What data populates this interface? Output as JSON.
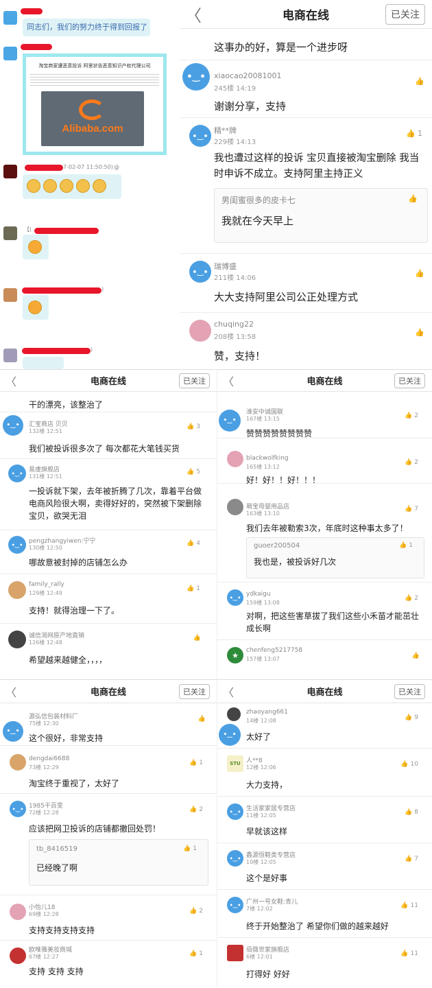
{
  "chat": {
    "message1": "同志们，我们的努力终于得到回报了",
    "news_headline": "淘宝商家遭恶意投诉 阿里状告恶意知识产权代理公司",
    "news_logo": "Alibaba.com",
    "timestamp": "7-02-07 11:50:50)",
    "at_sign": "@",
    "bracket1": "【(",
    "bracket2": ")",
    "bracket3": ")"
  },
  "panel1": {
    "header": {
      "back": "〈",
      "title": "电商在线",
      "follow": "已关注"
    },
    "posts": [
      {
        "text": "这事办的好，算是一个进步呀"
      },
      {
        "user": "xiaocao20081001",
        "meta": "245楼 14:19",
        "text": "谢谢分享，支持",
        "likes": ""
      },
      {
        "user": "精**牌",
        "meta": "229楼 14:13",
        "text": "我也遭过这样的投诉 宝贝直接被淘宝删除 我当时申诉不成立。支持阿里主持正义",
        "likes": "1",
        "reply": {
          "user": "男闺蜜很多的皮卡七",
          "text": "我就在今天早上"
        }
      },
      {
        "user": "瑞博盛",
        "meta": "211楼 14:06",
        "text": "大大支持阿里公司公正处理方式",
        "likes": ""
      },
      {
        "user": "chuqing22",
        "meta": "208楼 13:58",
        "text": "赞，支持！",
        "likes": ""
      }
    ]
  },
  "panel2": {
    "header": {
      "back": "〈",
      "title": "电商在线",
      "follow": "已关注"
    },
    "posts": [
      {
        "text": "干的漂亮，该整治了"
      },
      {
        "user": "汇宝商店 贝贝",
        "meta": "132楼 12:51",
        "text": "我们被投诉很多次了 每次都花大笔钱买货",
        "likes": "3"
      },
      {
        "user": "易虔旗舰店",
        "meta": "131楼 12:51",
        "text": "一投诉就下架，去年被折腾了几次，靠着平台做电商风险很大啊，卖得好好的，突然被下架删除宝贝，欲哭无泪",
        "likes": "5"
      },
      {
        "user": "pengzhangyiwen:宁宁",
        "meta": "130楼 12:50",
        "text": "哪故意被封掉的店铺怎么办",
        "likes": "4"
      },
      {
        "user": "family_rally",
        "meta": "129楼 12:49",
        "text": "支持！就得治理一下了。",
        "likes": "1"
      },
      {
        "user": "诚信渴网原产地直销",
        "meta": "126楼 12:48",
        "text": "希望越来越健全，，，，",
        "likes": ""
      }
    ]
  },
  "panel3": {
    "header": {
      "back": "〈",
      "title": "电商在线",
      "follow": "已关注"
    },
    "posts": [
      {
        "user": "淮安中诚国联",
        "meta": "167楼 13:15",
        "text": "赞赞赞赞赞赞赞赞",
        "likes": "2"
      },
      {
        "user": "blackwolfking",
        "meta": "165楼 13:12",
        "text": "好！好！！好！！！",
        "likes": "2"
      },
      {
        "user": "萌宝母婴用品店",
        "meta": "163楼 13:10",
        "text": "我们去年被勒索3次，年底时这种事太多了！",
        "likes": "7",
        "reply": {
          "user": "guoer200504",
          "text": "我也是，被投诉好几次",
          "likes": "1"
        }
      },
      {
        "user": "ydkaigu",
        "meta": "159楼 13:08",
        "text": "对啊，把这些害草拔了我们这些小禾苗才能茁壮成长啊",
        "likes": "2"
      },
      {
        "user": "chenfeng5217758",
        "meta": "157楼 13:07",
        "text": "",
        "likes": ""
      }
    ]
  },
  "panel4": {
    "header": {
      "back": "〈",
      "title": "电商在线",
      "follow": "已关注"
    },
    "posts": [
      {
        "user": "源弘信包装材料厂",
        "meta": "75楼 12:30",
        "text": "这个很好，非常支持",
        "likes": ""
      },
      {
        "user": "dengdai6688",
        "meta": "73楼 12:29",
        "text": "淘宝终于重视了，太好了",
        "likes": "1"
      },
      {
        "user": "1985干百变",
        "meta": "72楼 12:28",
        "text": "应该把网卫投诉的店铺都撤回处罚！",
        "likes": "2",
        "reply": {
          "user": "tb_8416519",
          "text": "已经晚了啊",
          "likes": "1"
        }
      },
      {
        "user": "小怡儿18",
        "meta": "69楼 12:28",
        "text": "支持支持支持支持",
        "likes": "2"
      },
      {
        "user": "欧唯雅美妆商城",
        "meta": "67楼 12:27",
        "text": "支持 支持 支持",
        "likes": "1"
      }
    ]
  },
  "panel5": {
    "header": {
      "back": "〈",
      "title": "电商在线",
      "follow": "已关注"
    },
    "posts": [
      {
        "user": "zhaoyang661",
        "meta": "14楼 12:08",
        "text": "太好了",
        "likes": "9"
      },
      {
        "user": "人**8",
        "meta": "12楼 12:06",
        "text": "大力支持，",
        "likes": "10"
      },
      {
        "user": "生活家家居专营店",
        "meta": "11楼 12:05",
        "text": "早就该这样",
        "likes": "8"
      },
      {
        "user": "鑫源恒鞋类专营店",
        "meta": "10楼 12:05",
        "text": "这个是好事",
        "likes": "7"
      },
      {
        "user": "广州一号女鞋:青儿",
        "meta": "7楼 12:02",
        "text": "终于开始整治了 希望你们做的越来越好",
        "likes": "11"
      },
      {
        "user": "佰薇世家旗舰店",
        "meta": "6楼 12:01",
        "text": "打得好 好好",
        "likes": "11"
      }
    ]
  },
  "icons": {
    "thumb": "thumbs-up-icon",
    "back": "chevron-left-icon"
  },
  "colors": {
    "redact": "#e8162a",
    "avatar_blue": "#4a9fe3",
    "bubble": "#dff3f6"
  }
}
